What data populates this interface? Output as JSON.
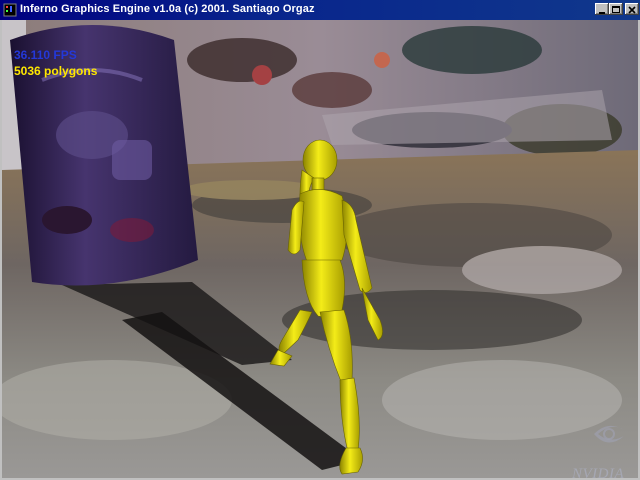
{
  "window": {
    "title": "Inferno Graphics Engine v1.0a (c) 2001. Santiago Orgaz",
    "icon": "app-icon",
    "controls": [
      "minimize-icon",
      "maximize-icon",
      "close-icon"
    ]
  },
  "hud": {
    "fps": "36.110 FPS",
    "polygons": "5036 polygons"
  },
  "watermark": "NVIDIA",
  "colors": {
    "title_bar": "#000080",
    "fps_text": "#2438d8",
    "polygon_text": "#ffe800",
    "figure": "#e8e010",
    "pillar": "#3a2a60"
  }
}
